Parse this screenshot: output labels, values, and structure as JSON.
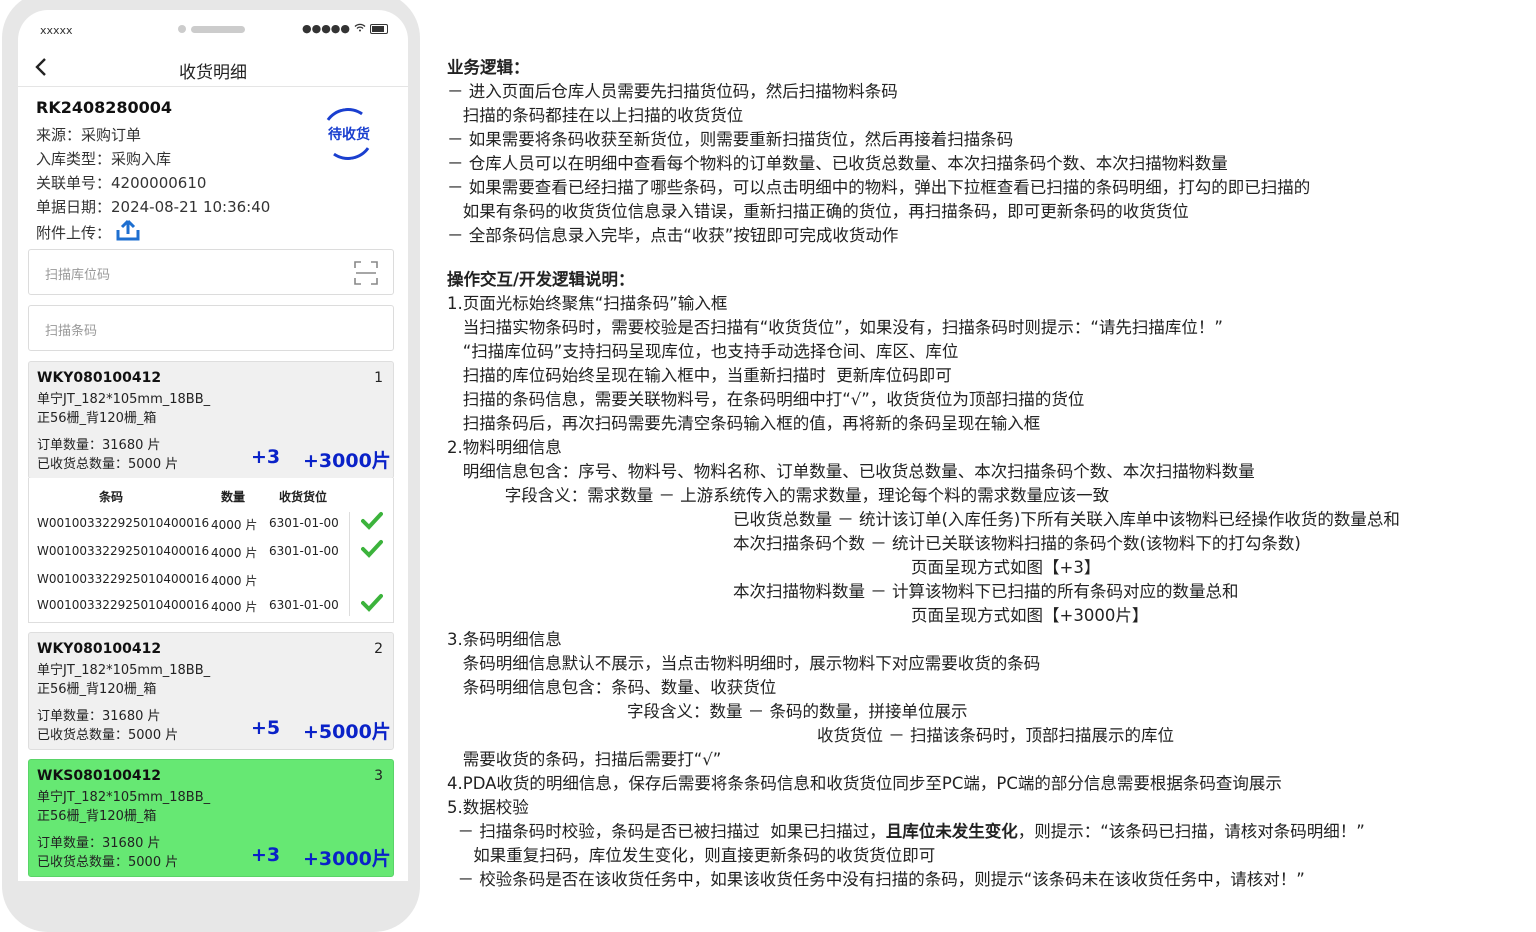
{
  "phone": {
    "status": {
      "carrier": "xxxxx",
      "signal": "●●●●●"
    },
    "nav": {
      "title": "收货明细"
    },
    "header": {
      "doc_no": "RK2408280004",
      "stamp": "待收货",
      "source": "来源：采购订单",
      "type": "入库类型：采购入库",
      "related": "关联单号：4200000610",
      "date": "单据日期：2024-08-21 10:36:40",
      "attach": "附件上传："
    },
    "inputs": {
      "location_placeholder": "扫描库位码",
      "barcode_placeholder": "扫描条码"
    },
    "cards": [
      {
        "code": "WKY080100412",
        "index": "1",
        "name1": "单宁JT_182*105mm_18BB_",
        "name2": "正56栅_背120栅_箱",
        "order": "订单数量：31680 片",
        "received": "已收货总数量：5000 片",
        "count": "+3",
        "qty": "+3000片"
      },
      {
        "code": "WKY080100412",
        "index": "2",
        "name1": "单宁JT_182*105mm_18BB_",
        "name2": "正56栅_背120栅_箱",
        "order": "订单数量：31680 片",
        "received": "已收货总数量：5000 片",
        "count": "+5",
        "qty": "+5000片"
      },
      {
        "code": "WKS080100412",
        "index": "3",
        "name1": "单宁JT_182*105mm_18BB_",
        "name2": "正56栅_背120栅_箱",
        "order": "订单数量：31680 片",
        "received": "已收货总数量：5000 片",
        "count": "+3",
        "qty": "+3000片"
      }
    ],
    "detail": {
      "headers": {
        "barcode": "条码",
        "qty": "数量",
        "location": "收货货位"
      },
      "rows": [
        {
          "barcode": "W001003322925010400016",
          "qty": "4000 片",
          "location": "6301-01-00",
          "checked": true
        },
        {
          "barcode": "W001003322925010400016",
          "qty": "4000 片",
          "location": "6301-01-00",
          "checked": true
        },
        {
          "barcode": "W001003322925010400016",
          "qty": "4000 片",
          "location": "",
          "checked": false
        },
        {
          "barcode": "W001003322925010400016",
          "qty": "4000 片",
          "location": "6301-01-00",
          "checked": true
        }
      ]
    },
    "colors": {
      "accent": "#0a22c8",
      "highlight_card": "#66e873",
      "check": "#3cb33c",
      "stamp": "#1a3fcf"
    }
  },
  "doc": {
    "l1": "业务逻辑：",
    "l2": "－ 进入页面后仓库人员需要先扫描货位码，然后扫描物料条码",
    "l3": "   扫描的条码都挂在以上扫描的收货货位",
    "l4": "－ 如果需要将条码收获至新货位，则需要重新扫描货位，然后再接着扫描条码",
    "l5": "－ 仓库人员可以在明细中查看每个物料的订单数量、已收货总数量、本次扫描条码个数、本次扫描物料数量",
    "l6": "－ 如果需要查看已经扫描了哪些条码，可以点击明细中的物料，弹出下拉框查看已扫描的条码明细，打勾的即已扫描的",
    "l7": "   如果有条码的收货货位信息录入错误，重新扫描正确的货位，再扫描条码，即可更新条码的收货货位",
    "l8": "－ 全部条码信息录入完毕，点击“收获”按钮即可完成收货动作",
    "l9": "操作交互/开发逻辑说明：",
    "l10": "1.页面光标始终聚焦“扫描条码”输入框",
    "l11": "   当扫描实物条码时，需要校验是否扫描有“收货货位”，如果没有，扫描条码时则提示：“请先扫描库位！”",
    "l12": "   “扫描库位码”支持扫码呈现库位，也支持手动选择仓间、库区、库位",
    "l13": "   扫描的库位码始终呈现在输入框中，当重新扫描时  更新库位码即可",
    "l14": "   扫描的条码信息，需要关联物料号，在条码明细中打“√”，收货货位为顶部扫描的货位",
    "l15": "   扫描条码后，再次扫码需要先清空条码输入框的值，再将新的条码呈现在输入框",
    "l16": "2.物料明细信息",
    "l17": "   明细信息包含：序号、物料号、物料名称、订单数量、已收货总数量、本次扫描条码个数、本次扫描物料数量",
    "l18": "           字段含义：需求数量 － 上游系统传入的需求数量，理论每个料的需求数量应该一致",
    "l19": "已收货总数量 － 统计该订单(入库任务)下所有关联入库单中该物料已经操作收货的数量总和",
    "l20": "本次扫描条码个数 － 统计已关联该物料扫描的条码个数(该物料下的打勾条数)",
    "l21": "页面呈现方式如图【+3】",
    "l22": "本次扫描物料数量 － 计算该物料下已扫描的所有条码对应的数量总和",
    "l23": "页面呈现方式如图【+3000片】",
    "l24": "3.条码明细信息",
    "l25": "   条码明细信息默认不展示，当点击物料明细时，展示物料下对应需要收货的条码",
    "l26": "   条码明细信息包含：条码、数量、收获货位",
    "l27": "字段含义：数量 － 条码的数量，拼接单位展示",
    "l28": "收货货位 － 扫描该条码时，顶部扫描展示的库位",
    "l29": "   需要收货的条码，扫描后需要打“√”",
    "l30": "4.PDA收货的明细信息，保存后需要将条条码信息和收货货位同步至PC端，PC端的部分信息需要根据条码查询展示",
    "l31": "5.数据校验",
    "l32a": "  － 扫描条码时校验，条码是否已被扫描过  如果已扫描过，",
    "l32b": "且库位未发生变化",
    "l32c": "，则提示：“该条码已扫描，请核对条码明细！”",
    "l33": "     如果重复扫码，库位发生变化，则直接更新条码的收货货位即可",
    "l34": "  － 校验条码是否在该收货任务中，如果该收货任务中没有扫描的条码，则提示“该条码未在该收货任务中，请核对！”"
  }
}
